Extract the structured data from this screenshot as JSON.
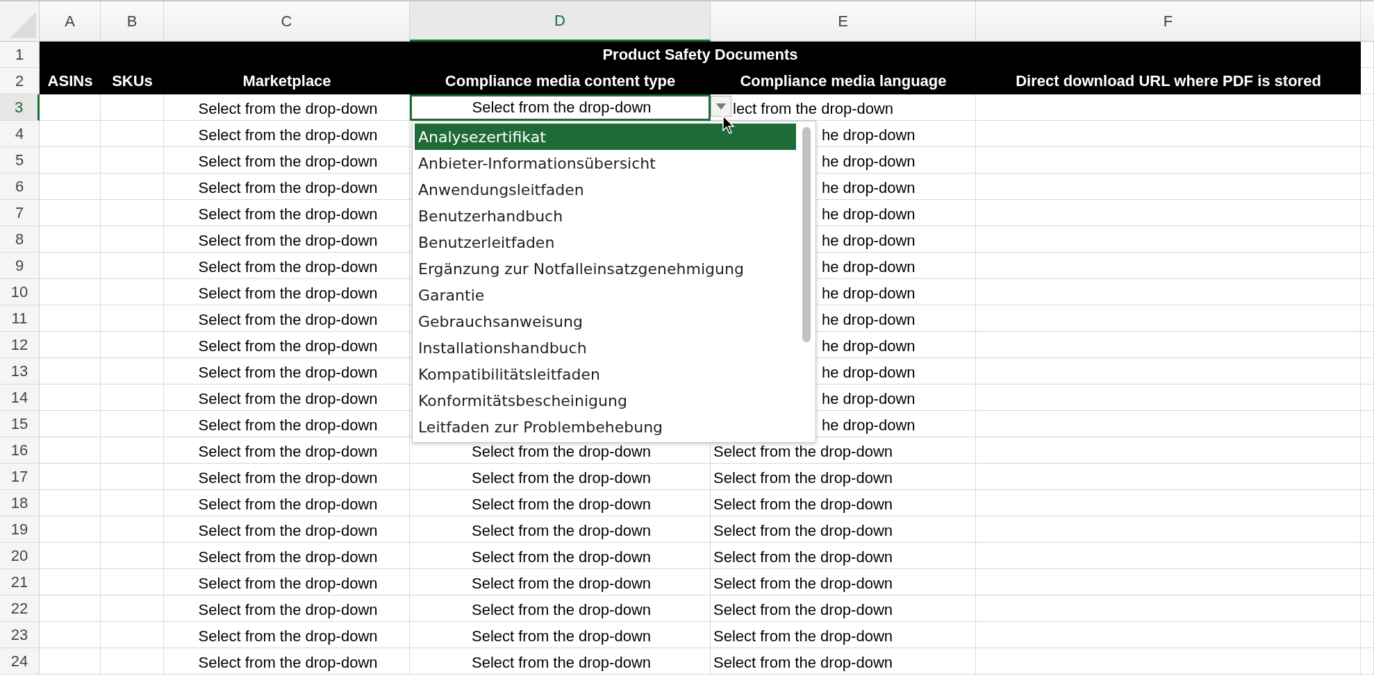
{
  "columns": [
    {
      "label": "A",
      "selected": false
    },
    {
      "label": "B",
      "selected": false
    },
    {
      "label": "C",
      "selected": false
    },
    {
      "label": "D",
      "selected": true
    },
    {
      "label": "E",
      "selected": false
    },
    {
      "label": "F",
      "selected": false
    }
  ],
  "header_rows": [
    "1",
    "2"
  ],
  "title": "Product Safety Documents",
  "headers": [
    "ASINs",
    "SKUs",
    "Marketplace",
    "Compliance media content type",
    "Compliance media language",
    "Direct download URL where PDF is stored"
  ],
  "rows": [
    {
      "number": "3",
      "active": true,
      "c": "Select from the drop-down",
      "d": "Select from the drop-down",
      "e": "lect from the drop-down"
    },
    {
      "number": "4",
      "active": false,
      "c": "Select from the drop-down",
      "e": "he drop-down"
    },
    {
      "number": "5",
      "active": false,
      "c": "Select from the drop-down",
      "e": "he drop-down"
    },
    {
      "number": "6",
      "active": false,
      "c": "Select from the drop-down",
      "e": "he drop-down"
    },
    {
      "number": "7",
      "active": false,
      "c": "Select from the drop-down",
      "e": "he drop-down"
    },
    {
      "number": "8",
      "active": false,
      "c": "Select from the drop-down",
      "e": "he drop-down"
    },
    {
      "number": "9",
      "active": false,
      "c": "Select from the drop-down",
      "e": "he drop-down"
    },
    {
      "number": "10",
      "active": false,
      "c": "Select from the drop-down",
      "e": "he drop-down"
    },
    {
      "number": "11",
      "active": false,
      "c": "Select from the drop-down",
      "e": "he drop-down"
    },
    {
      "number": "12",
      "active": false,
      "c": "Select from the drop-down",
      "e": "he drop-down"
    },
    {
      "number": "13",
      "active": false,
      "c": "Select from the drop-down",
      "e": "he drop-down"
    },
    {
      "number": "14",
      "active": false,
      "c": "Select from the drop-down",
      "e": "he drop-down"
    },
    {
      "number": "15",
      "active": false,
      "c": "Select from the drop-down",
      "e": "he drop-down"
    },
    {
      "number": "16",
      "active": false,
      "c": "Select from the drop-down",
      "d": "Select from the drop-down",
      "e": "Select from the drop-down"
    },
    {
      "number": "17",
      "active": false,
      "c": "Select from the drop-down",
      "d": "Select from the drop-down",
      "e": "Select from the drop-down"
    },
    {
      "number": "18",
      "active": false,
      "c": "Select from the drop-down",
      "d": "Select from the drop-down",
      "e": "Select from the drop-down"
    },
    {
      "number": "19",
      "active": false,
      "c": "Select from the drop-down",
      "d": "Select from the drop-down",
      "e": "Select from the drop-down"
    },
    {
      "number": "20",
      "active": false,
      "c": "Select from the drop-down",
      "d": "Select from the drop-down",
      "e": "Select from the drop-down"
    },
    {
      "number": "21",
      "active": false,
      "c": "Select from the drop-down",
      "d": "Select from the drop-down",
      "e": "Select from the drop-down"
    },
    {
      "number": "22",
      "active": false,
      "c": "Select from the drop-down",
      "d": "Select from the drop-down",
      "e": "Select from the drop-down"
    },
    {
      "number": "23",
      "active": false,
      "c": "Select from the drop-down",
      "d": "Select from the drop-down",
      "e": "Select from the drop-down"
    },
    {
      "number": "24",
      "active": false,
      "c": "Select from the drop-down",
      "d": "Select from the drop-down",
      "e": "Select from the drop-down"
    }
  ],
  "dropdown": {
    "options": [
      {
        "label": "Analysezertifikat",
        "selected": true
      },
      {
        "label": "Anbieter-Informationsübersicht",
        "selected": false
      },
      {
        "label": "Anwendungsleitfaden",
        "selected": false
      },
      {
        "label": "Benutzerhandbuch",
        "selected": false
      },
      {
        "label": "Benutzerleitfaden",
        "selected": false
      },
      {
        "label": "Ergänzung zur Notfalleinsatzgenehmigung",
        "selected": false
      },
      {
        "label": "Garantie",
        "selected": false
      },
      {
        "label": "Gebrauchsanweisung",
        "selected": false
      },
      {
        "label": "Installationshandbuch",
        "selected": false
      },
      {
        "label": "Kompatibilitätsleitfaden",
        "selected": false
      },
      {
        "label": "Konformitätsbescheinigung",
        "selected": false
      },
      {
        "label": "Leitfaden zur Problembehebung",
        "selected": false
      }
    ]
  }
}
